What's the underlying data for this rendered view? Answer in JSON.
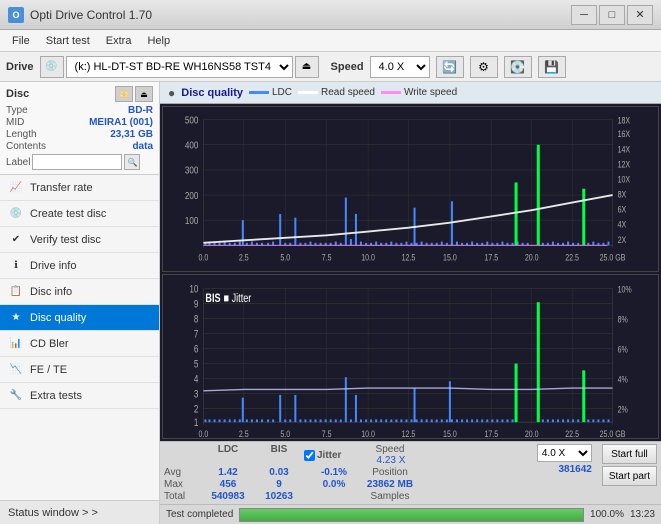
{
  "titleBar": {
    "title": "Opti Drive Control 1.70",
    "minBtn": "─",
    "maxBtn": "□",
    "closeBtn": "✕"
  },
  "menuBar": {
    "items": [
      "File",
      "Start test",
      "Extra",
      "Help"
    ]
  },
  "driveBar": {
    "label": "Drive",
    "driveValue": "(k:)  HL-DT-ST BD-RE  WH16NS58 TST4",
    "speedLabel": "Speed",
    "speedValue": "4.0 X"
  },
  "disc": {
    "title": "Disc",
    "typeLabel": "Type",
    "typeValue": "BD-R",
    "midLabel": "MID",
    "midValue": "MEIRA1 (001)",
    "lengthLabel": "Length",
    "lengthValue": "23,31 GB",
    "contentsLabel": "Contents",
    "contentsValue": "data",
    "labelLabel": "Label",
    "labelValue": ""
  },
  "navItems": [
    {
      "id": "transfer-rate",
      "label": "Transfer rate",
      "icon": "📈"
    },
    {
      "id": "create-test-disc",
      "label": "Create test disc",
      "icon": "💿"
    },
    {
      "id": "verify-test-disc",
      "label": "Verify test disc",
      "icon": "✔"
    },
    {
      "id": "drive-info",
      "label": "Drive info",
      "icon": "ℹ"
    },
    {
      "id": "disc-info",
      "label": "Disc info",
      "icon": "📋"
    },
    {
      "id": "disc-quality",
      "label": "Disc quality",
      "icon": "★",
      "active": true
    },
    {
      "id": "cd-bler",
      "label": "CD Bler",
      "icon": "📊"
    },
    {
      "id": "fe-te",
      "label": "FE / TE",
      "icon": "📉"
    },
    {
      "id": "extra-tests",
      "label": "Extra tests",
      "icon": "🔧"
    }
  ],
  "statusWindow": {
    "label": "Status window > >"
  },
  "discQuality": {
    "title": "Disc quality",
    "legends": [
      {
        "id": "ldc",
        "label": "LDC",
        "color": "#4488ff"
      },
      {
        "id": "read-speed",
        "label": "Read speed",
        "color": "#ffffff"
      },
      {
        "id": "write-speed",
        "label": "Write speed",
        "color": "#ff88ff"
      }
    ],
    "chart1": {
      "title": "LDC",
      "yAxisMax": 500,
      "yAxisLabels": [
        "500",
        "400",
        "300",
        "200",
        "100",
        "0"
      ],
      "yAxisRight": [
        "18X",
        "16X",
        "14X",
        "12X",
        "10X",
        "8X",
        "6X",
        "4X",
        "2X"
      ],
      "xAxisLabels": [
        "0.0",
        "2.5",
        "5.0",
        "7.5",
        "10.0",
        "12.5",
        "15.0",
        "17.5",
        "20.0",
        "22.5",
        "25.0 GB"
      ]
    },
    "chart2": {
      "title": "BIS",
      "yAxisMax": 10,
      "yAxisLabels": [
        "10",
        "9",
        "8",
        "7",
        "6",
        "5",
        "4",
        "3",
        "2",
        "1"
      ],
      "yAxisRight": [
        "10%",
        "8%",
        "6%",
        "4%",
        "2%"
      ],
      "xAxisLabels": [
        "0.0",
        "2.5",
        "5.0",
        "7.5",
        "10.0",
        "12.5",
        "15.0",
        "17.5",
        "20.0",
        "22.5",
        "25.0 GB"
      ],
      "jitterLabel": "Jitter"
    }
  },
  "stats": {
    "headers": [
      "",
      "LDC",
      "BIS",
      "",
      "Jitter",
      "Speed",
      ""
    ],
    "avgLabel": "Avg",
    "maxLabel": "Max",
    "totalLabel": "Total",
    "avgLdc": "1.42",
    "avgBis": "0.03",
    "avgJitter": "-0.1%",
    "maxLdc": "456",
    "maxBis": "9",
    "maxJitter": "0.0%",
    "totalLdc": "540983",
    "totalBis": "10263",
    "speedLabel": "Speed",
    "speedValue": "4.23 X",
    "speedSelect": "4.0 X",
    "positionLabel": "Position",
    "positionValue": "23862 MB",
    "samplesLabel": "Samples",
    "samplesValue": "381642",
    "startFullBtn": "Start full",
    "startPartBtn": "Start part"
  },
  "progress": {
    "percent": "100.0%",
    "fillWidth": "100",
    "time": "13:23"
  },
  "statusCompleted": "Test completed"
}
